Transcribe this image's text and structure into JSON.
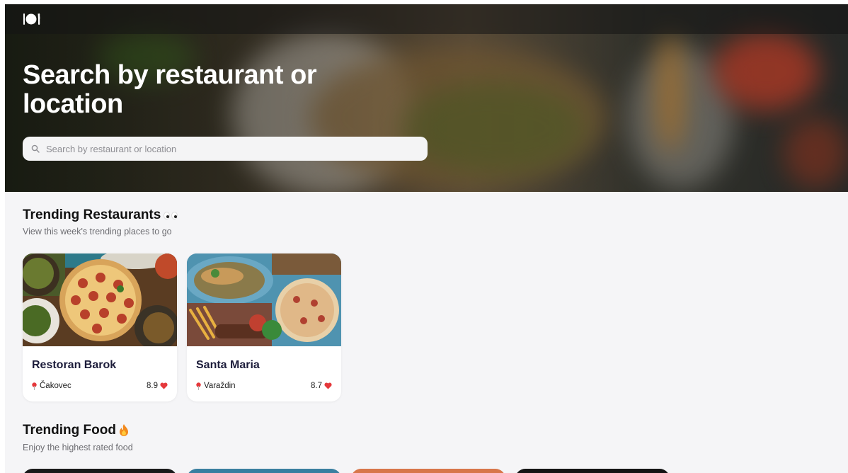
{
  "hero": {
    "title": "Search by restaurant or location",
    "search_placeholder": "Search by restaurant or location"
  },
  "trending_restaurants": {
    "title": "Trending Restaurants",
    "subtitle": "View this week's trending places to go",
    "cards": [
      {
        "name": "Restoran Barok",
        "location": "Čakovec",
        "rating": "8.9"
      },
      {
        "name": "Santa Maria",
        "location": "Varaždin",
        "rating": "8.7"
      }
    ]
  },
  "trending_food": {
    "title": "Trending Food",
    "subtitle": "Enjoy the highest rated food"
  },
  "colors": {
    "background": "#f5f5f7",
    "heart": "#e5383b",
    "pin": "#e5383b",
    "card_title": "#1c1c3a"
  },
  "icons": [
    "plate-cutlery-icon",
    "search-icon",
    "eyes-emoji-icon",
    "location-pin-icon",
    "heart-icon",
    "fire-emoji-icon"
  ]
}
